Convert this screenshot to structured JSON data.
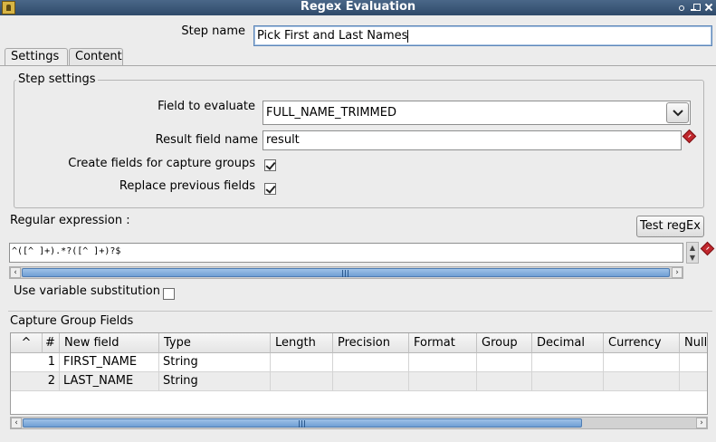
{
  "window": {
    "title": "Regex Evaluation"
  },
  "step": {
    "label": "Step name",
    "value": "Pick First and Last Names"
  },
  "tabs": [
    {
      "label": "Settings"
    },
    {
      "label": "Content"
    }
  ],
  "settings": {
    "group_label": "Step settings",
    "field_to_evaluate": {
      "label": "Field to evaluate",
      "value": "FULL_NAME_TRIMMED"
    },
    "result_field": {
      "label": "Result field name",
      "value": "result"
    },
    "capture_groups": {
      "label": "Create fields for capture groups",
      "checked": true
    },
    "replace_previous": {
      "label": "Replace previous fields",
      "checked": true
    }
  },
  "regex": {
    "label": "Regular expression :",
    "test_button": "Test regEx",
    "value": "^([^ ]+).*?([^ ]+)?$",
    "use_variable_label": "Use variable substitution",
    "use_variable_checked": false
  },
  "capture": {
    "group_label": "Capture Group Fields",
    "columns": [
      "^",
      "#",
      "New field",
      "Type",
      "Length",
      "Precision",
      "Format",
      "Group",
      "Decimal",
      "Currency",
      "Null I"
    ],
    "rows": [
      {
        "num": "1",
        "new_field": "FIRST_NAME",
        "type": "String"
      },
      {
        "num": "2",
        "new_field": "LAST_NAME",
        "type": "String"
      }
    ]
  },
  "colors": {
    "titlebar": "#3d5a7c",
    "scroll_thumb": "#7fa9da",
    "warn": "#c0272d"
  }
}
